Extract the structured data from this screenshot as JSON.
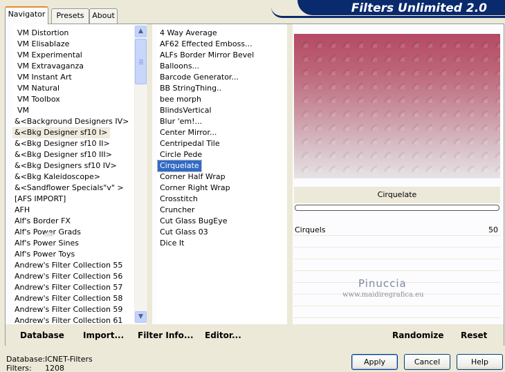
{
  "app": {
    "title": "Filters Unlimited 2.0"
  },
  "tabs": [
    {
      "label": "Navigator",
      "active": true
    },
    {
      "label": "Presets",
      "active": false
    },
    {
      "label": "About",
      "active": false
    }
  ],
  "categories": {
    "items": [
      "VM Distortion",
      "VM Elisablaze",
      "VM Experimental",
      "VM Extravaganza",
      "VM Instant Art",
      "VM Natural",
      "VM Toolbox",
      "VM",
      "&<Background Designers IV>",
      "&<Bkg Designer sf10 I>",
      "&<Bkg Designer sf10 II>",
      "&<Bkg Designer sf10 III>",
      "&<Bkg Designers sf10 IV>",
      "&<Bkg Kaleidoscope>",
      "&<Sandflower Specials\"v\" >",
      "[AFS IMPORT]",
      "AFH",
      "Alf's Border FX",
      "Alf's Power Grads",
      "Alf's Power Sines",
      "Alf's Power Toys",
      "Andrew's Filter Collection 55",
      "Andrew's Filter Collection 56",
      "Andrew's Filter Collection 57",
      "Andrew's Filter Collection 58",
      "Andrew's Filter Collection 59",
      "Andrew's Filter Collection 61"
    ],
    "selected_index": 9,
    "scroll_up_icon": "arrow-up-icon",
    "scroll_down_icon": "arrow-down-icon"
  },
  "filters": {
    "items": [
      "4 Way Average",
      "AF62 Effected Emboss...",
      "ALFs Border Mirror Bevel",
      "Balloons...",
      "Barcode Generator...",
      "BB StringThing..",
      "bee morph",
      "BlindsVertical",
      "Blur 'em!...",
      "Center Mirror...",
      "Centripedal Tile",
      "Circle Pede",
      "Cirquelate",
      "Corner Half Wrap",
      "Corner Right Wrap",
      "Crosstitch",
      "Cruncher",
      "Cut Glass  BugEye",
      "Cut Glass 03",
      "Dice It"
    ],
    "selected_index": 12
  },
  "preview": {
    "filter_name": "Cirquelate",
    "colors": {
      "top": "#b44a64",
      "bottom": "#e7e3e6"
    }
  },
  "parameters": [
    {
      "label": "Cirquels",
      "value": "50"
    }
  ],
  "watermark": {
    "name": "Pinuccia",
    "site": "www.maidiregrafica.eu"
  },
  "panel_buttons": {
    "database": "Database",
    "import": "Import...",
    "filter_info": "Filter Info...",
    "editor": "Editor...",
    "randomize": "Randomize",
    "reset": "Reset"
  },
  "footer": {
    "database_label": "Database:",
    "database_value": "ICNET-Filters",
    "filters_label": "Filters:",
    "filters_value": "1208"
  },
  "dialog_buttons": {
    "apply": "Apply",
    "cancel": "Cancel",
    "help": "Help"
  }
}
